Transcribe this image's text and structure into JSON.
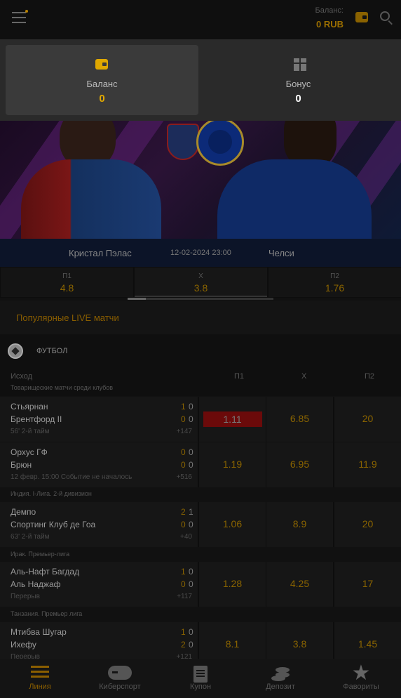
{
  "header": {
    "balance_label": "Баланс:",
    "balance_value": "0 RUB"
  },
  "dropdown": {
    "balance_label": "Баланс",
    "balance_value": "0",
    "bonus_label": "Бонус",
    "bonus_value": "0"
  },
  "featured": {
    "home": "Кристал Пэлас",
    "date": "12-02-2024 23:00",
    "away": "Челси",
    "odds": [
      {
        "label": "П1",
        "value": "4.8"
      },
      {
        "label": "Х",
        "value": "3.8"
      },
      {
        "label": "П2",
        "value": "1.76"
      }
    ]
  },
  "popular_title": "Популярные LIVE матчи",
  "sport": "ФУТБОЛ",
  "table_head": {
    "outcome": "Исход",
    "p1": "П1",
    "x": "Х",
    "p2": "П2"
  },
  "leagues": [
    "Товарищеские матчи среди клубов",
    "Индия. I-Лига. 2-й дивизион",
    "Ирак. Премьер-лига",
    "Танзания. Премьер лига"
  ],
  "matches": [
    {
      "t1": "Стьярнан",
      "t2": "Брентфорд II",
      "s1a": "1",
      "s1b": "0",
      "s2a": "0",
      "s2b": "0",
      "status": "56' 2-й тайм",
      "more": "+147",
      "o1": "1.11",
      "o2": "6.85",
      "o3": "20"
    },
    {
      "t1": "Орхус ГФ",
      "t2": "Брюн",
      "s1a": "0",
      "s1b": "0",
      "s2a": "0",
      "s2b": "0",
      "status": "12 февр. 15:00 Событие не началось",
      "more": "+516",
      "o1": "1.19",
      "o2": "6.95",
      "o3": "11.9"
    },
    {
      "t1": "Демпо",
      "t2": "Спортинг Клуб де Гоа",
      "s1a": "2",
      "s1b": "1",
      "s2a": "0",
      "s2b": "0",
      "status": "63' 2-й тайм",
      "more": "+40",
      "o1": "1.06",
      "o2": "8.9",
      "o3": "20"
    },
    {
      "t1": "Аль-Нафт Багдад",
      "t2": "Аль Наджаф",
      "s1a": "1",
      "s1b": "0",
      "s2a": "0",
      "s2b": "0",
      "status": "Перерыв",
      "more": "+117",
      "o1": "1.28",
      "o2": "4.25",
      "o3": "17"
    },
    {
      "t1": "Мтибва Шугар",
      "t2": "Ихефу",
      "s1a": "1",
      "s1b": "0",
      "s2a": "2",
      "s2b": "0",
      "status": "Перерыв",
      "more": "+121",
      "o1": "8.1",
      "o2": "3.8",
      "o3": "1.45"
    }
  ],
  "nav": [
    {
      "label": "Линия",
      "icon": "lines-icon",
      "active": true
    },
    {
      "label": "Киберспорт",
      "icon": "gamepad-icon"
    },
    {
      "label": "Купон",
      "icon": "coupon-icon"
    },
    {
      "label": "Депозит",
      "icon": "coins-icon"
    },
    {
      "label": "Фавориты",
      "icon": "star-icon"
    }
  ],
  "colors": {
    "accent": "#e0a800",
    "hot_odd": "#6b0a0a",
    "background": "#111111"
  }
}
